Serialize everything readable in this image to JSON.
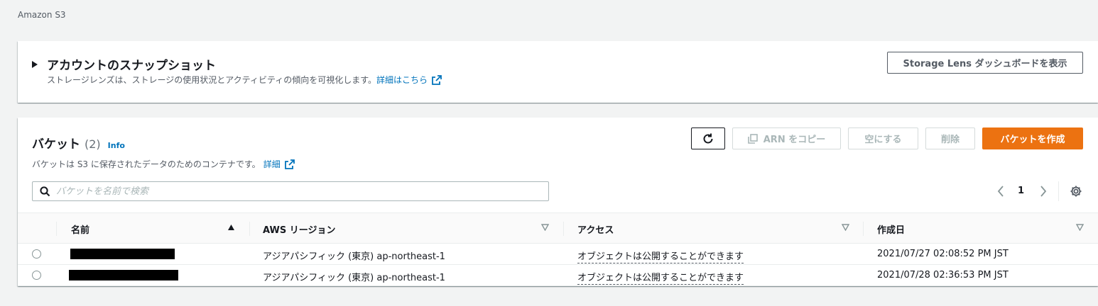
{
  "breadcrumb": "Amazon S3",
  "snapshot": {
    "title": "アカウントのスナップショット",
    "description": "ストレージレンズは、ストレージの使用状況とアクティビティの傾向を可視化します。",
    "link": "詳細はこちら",
    "button": "Storage Lens ダッシュボードを表示"
  },
  "buckets": {
    "title": "バケット",
    "count": "(2)",
    "info": "Info",
    "description": "バケットは S3 に保存されたデータのためのコンテナです。",
    "link": "詳細",
    "buttons": {
      "copy_arn": "ARN をコピー",
      "empty": "空にする",
      "delete": "削除",
      "create": "バケットを作成"
    },
    "search_placeholder": "バケットを名前で検索",
    "page": "1",
    "columns": [
      "名前",
      "AWS リージョン",
      "アクセス",
      "作成日"
    ],
    "rows": [
      {
        "region": "アジアパシフィック (東京) ap-northeast-1",
        "access": "オブジェクトは公開することができます",
        "created": "2021/07/27 02:08:52 PM JST"
      },
      {
        "region": "アジアパシフィック (東京) ap-northeast-1",
        "access": "オブジェクトは公開することができます",
        "created": "2021/07/28 02:36:53 PM JST"
      }
    ]
  },
  "colors": {
    "primary": "#ec7211",
    "link": "#0073bb"
  }
}
